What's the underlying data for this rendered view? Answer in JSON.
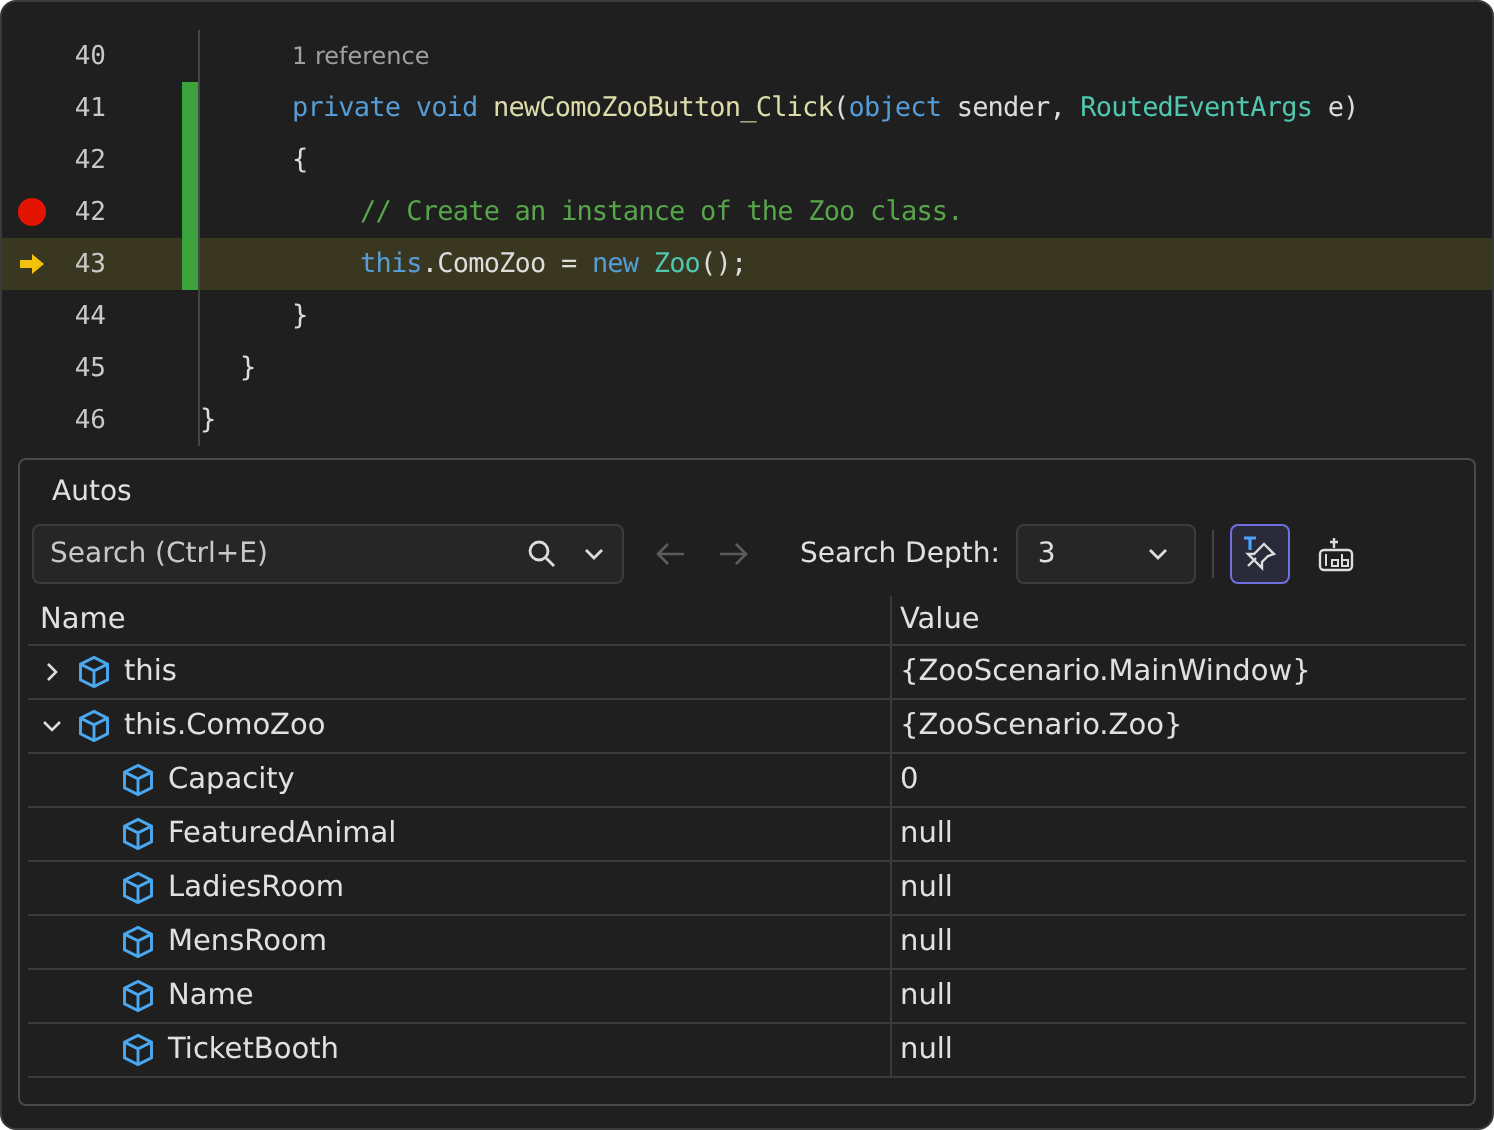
{
  "editor": {
    "lines": [
      {
        "number": "40",
        "breakpoint": false,
        "current": false,
        "changed": false,
        "kind": "codelens",
        "text": "1 reference"
      },
      {
        "number": "41",
        "breakpoint": false,
        "current": false,
        "changed": true,
        "kind": "code",
        "tokens": [
          {
            "kind": "keyword",
            "text": "private"
          },
          {
            "kind": "keyword",
            "text": " void"
          },
          {
            "kind": "method",
            "text": " newComoZooButton_Click"
          },
          {
            "kind": "plain",
            "text": "("
          },
          {
            "kind": "keyword",
            "text": "object"
          },
          {
            "kind": "plain",
            "text": " sender, "
          },
          {
            "kind": "type",
            "text": "RoutedEventArgs"
          },
          {
            "kind": "plain",
            "text": " e)"
          }
        ]
      },
      {
        "number": "42",
        "breakpoint": false,
        "current": false,
        "changed": true,
        "kind": "code",
        "tokens": [
          {
            "kind": "plain",
            "text": "{"
          }
        ]
      },
      {
        "number": "42",
        "breakpoint": true,
        "current": false,
        "changed": true,
        "kind": "code",
        "tokens": [
          {
            "kind": "comment",
            "text": "// Create an instance of the Zoo class."
          }
        ]
      },
      {
        "number": "43",
        "breakpoint": false,
        "current": true,
        "changed": true,
        "kind": "code",
        "tokens": [
          {
            "kind": "keyword",
            "text": "this"
          },
          {
            "kind": "plain",
            "text": ".ComoZoo = "
          },
          {
            "kind": "keyword",
            "text": "new"
          },
          {
            "kind": "type",
            "text": " Zoo"
          },
          {
            "kind": "plain",
            "text": "();"
          }
        ]
      },
      {
        "number": "44",
        "breakpoint": false,
        "current": false,
        "changed": false,
        "kind": "code",
        "tokens": [
          {
            "kind": "plain",
            "text": "}"
          }
        ]
      },
      {
        "number": "45",
        "breakpoint": false,
        "current": false,
        "changed": false,
        "kind": "code",
        "tokens": [
          {
            "kind": "plain",
            "text": "}"
          }
        ]
      },
      {
        "number": "46",
        "breakpoint": false,
        "current": false,
        "changed": false,
        "kind": "code",
        "tokens": [
          {
            "kind": "plain",
            "text": "}"
          }
        ]
      }
    ]
  },
  "autos": {
    "title": "Autos",
    "search": {
      "placeholder": "Search (Ctrl+E)"
    },
    "back": {
      "disabled": true
    },
    "forward": {
      "disabled": true
    },
    "depth": {
      "label": "Search Depth:",
      "value": "3"
    },
    "pin_button": {
      "selected": true
    },
    "table": {
      "columns": [
        "Name",
        "Value"
      ],
      "rows": [
        {
          "name": "this",
          "value": "{ZooScenario.MainWindow}",
          "expanded": false
        },
        {
          "name": "this.ComoZoo",
          "value": "{ZooScenario.Zoo}",
          "expanded": true,
          "children": [
            {
              "name": "Capacity",
              "value": "0"
            },
            {
              "name": "FeaturedAnimal",
              "value": "null"
            },
            {
              "name": "LadiesRoom",
              "value": "null"
            },
            {
              "name": "MensRoom",
              "value": "null"
            },
            {
              "name": "Name",
              "value": "null"
            },
            {
              "name": "TicketBooth",
              "value": "null"
            }
          ]
        }
      ]
    }
  }
}
